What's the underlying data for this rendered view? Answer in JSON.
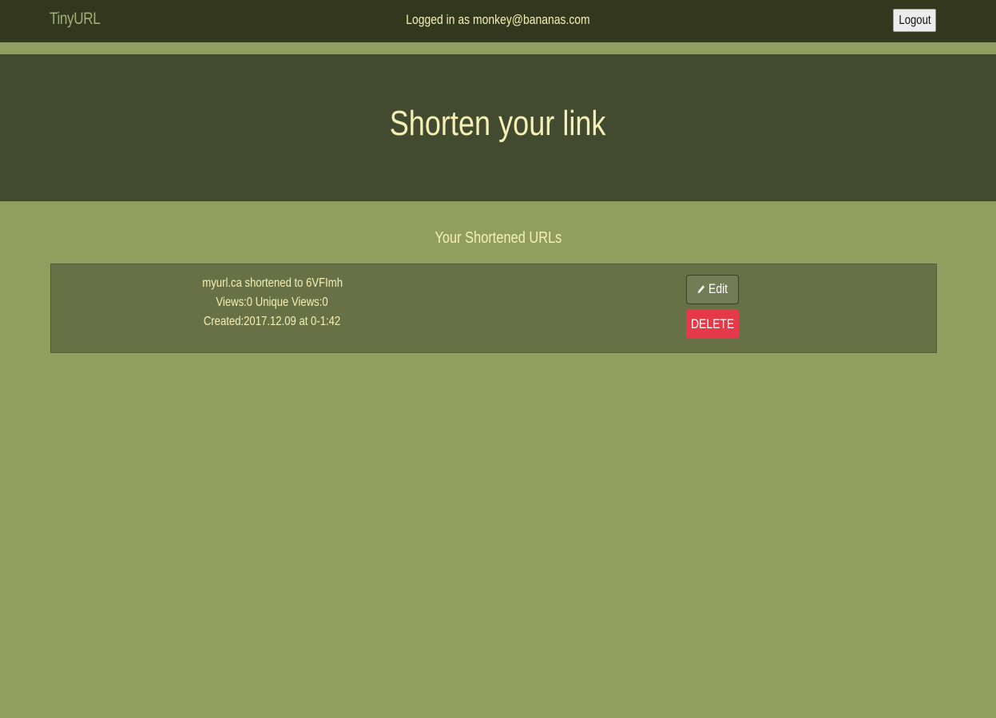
{
  "navbar": {
    "brand": "TinyURL",
    "logged_in_text": "Logged in as monkey@bananas.com",
    "logout_label": "Logout"
  },
  "hero": {
    "title": "Shorten your link"
  },
  "urls_section": {
    "title": "Your Shortened URLs",
    "items": [
      {
        "summary": "myurl.ca shortened to 6VFImh",
        "views": "Views:0 Unique Views:0",
        "created": "Created:2017.12.09 at 0-1:42",
        "edit_label": "Edit",
        "delete_label": "DELETE"
      }
    ]
  },
  "colors": {
    "page_bg": "#929e60",
    "navbar_bg": "#32371d",
    "hero_bg": "#424a30",
    "card_bg": "#687146",
    "text_accent": "#f3efb5",
    "delete_red": "#e5394a"
  },
  "icons": {
    "edit": "pencil-icon"
  }
}
